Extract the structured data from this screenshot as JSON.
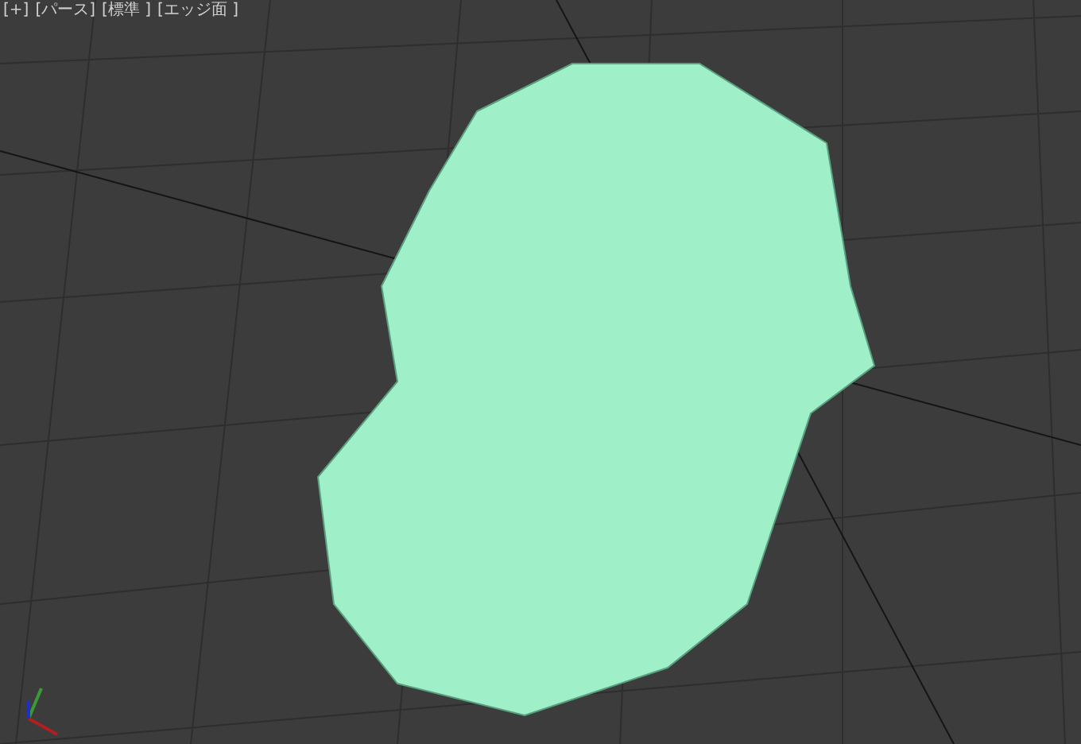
{
  "viewport": {
    "labels": [
      "[+]",
      "[パース]",
      "[標準 ]",
      "[エッジ面 ]"
    ]
  }
}
